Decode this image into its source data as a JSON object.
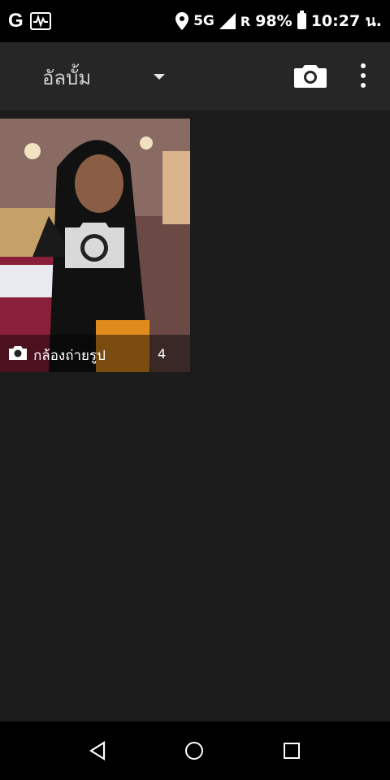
{
  "status_bar": {
    "left_icons": [
      "google-icon",
      "pulse-icon"
    ],
    "network_label": "5G",
    "network_sub": "G",
    "network_sup": "5G",
    "roaming": "R",
    "battery": "98%",
    "time": "10:27 น."
  },
  "toolbar": {
    "album_title": "อัลบั้ม",
    "icons": [
      "dropdown-arrow-icon",
      "camera-icon",
      "more-vert-icon"
    ]
  },
  "album": {
    "label": "กล้องถ่ายรูป",
    "count": "4"
  },
  "colors": {
    "background": "#1b1b1b",
    "toolbar": "#262626",
    "status_bar": "#000000"
  }
}
